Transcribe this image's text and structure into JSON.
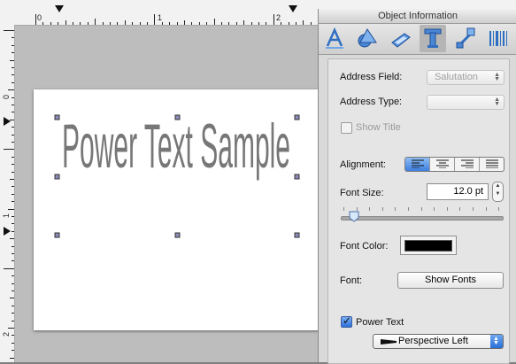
{
  "window": {
    "title": "Object Information"
  },
  "ruler": {
    "horizontal_numbers": [
      "0",
      "1",
      "2"
    ],
    "vertical_numbers": [
      "0",
      "1",
      "2"
    ]
  },
  "canvas": {
    "power_text": "Power Text Sample",
    "text_color": "#777777"
  },
  "toolbar": {
    "tools": [
      {
        "name": "position-size-icon",
        "selected": false
      },
      {
        "name": "graphics-icon",
        "selected": false
      },
      {
        "name": "image-icon",
        "selected": false
      },
      {
        "name": "text-icon",
        "selected": true
      },
      {
        "name": "transform-icon",
        "selected": false
      },
      {
        "name": "barcode-icon",
        "selected": false
      }
    ]
  },
  "inspector": {
    "address_field_label": "Address Field:",
    "address_field_value": "Salutation",
    "address_type_label": "Address Type:",
    "address_type_value": "",
    "show_title_label": "Show Title",
    "alignment_label": "Alignment:",
    "alignment_selected": "left",
    "font_size_label": "Font Size:",
    "font_size_value": "12.0 pt",
    "font_color_label": "Font Color:",
    "font_color_value": "#000000",
    "font_label": "Font:",
    "show_fonts_label": "Show Fonts",
    "power_text_label": "Power Text",
    "power_text_checked": true,
    "effect_value": "Perspective Left"
  }
}
